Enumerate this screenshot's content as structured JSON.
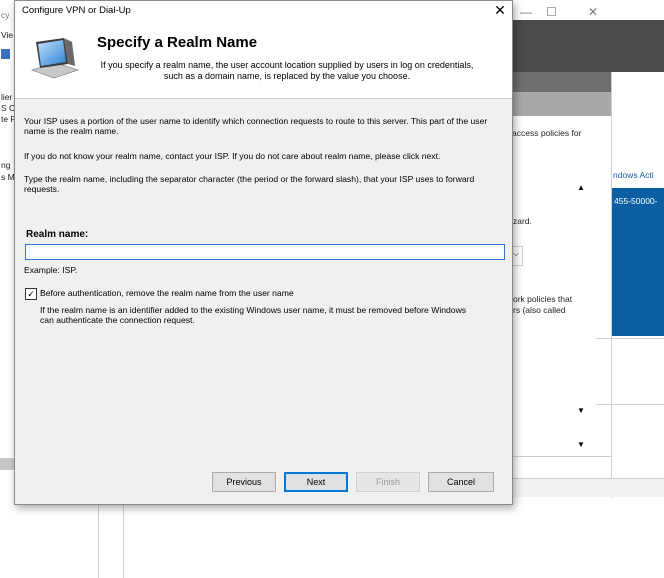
{
  "background": {
    "left_fragments": [
      "cy",
      "Vie",
      "lier",
      "S C",
      "te F",
      "ng",
      "s M"
    ],
    "right_texts": {
      "access_policies": "access policies for",
      "windows_activation": "ndows Acti",
      "product_id": "455-50000-",
      "wizard": "zard.",
      "network_policies_1": "ork policies that",
      "network_policies_2": "rs (also called"
    },
    "minimize_glyph": "—",
    "maximize_glyph": "☐",
    "close_glyph": "✕",
    "scroll_up_glyph": "▲",
    "dropdown_glyph": "▼",
    "chevron_glyph": "⌵"
  },
  "dialog": {
    "title": "Configure VPN or Dial-Up",
    "close_glyph": "✕",
    "header": {
      "title": "Specify a Realm Name",
      "description": "If you specify a realm name, the user account location supplied by users in log on credentials, such as a domain name, is replaced by the value you choose."
    },
    "body": {
      "para1": "Your ISP uses a portion of the user name to identify which connection requests to route to this server. This part of the user name is the realm name.",
      "para2": "If you do not know your realm name, contact your ISP. If you do not care about realm name, please click next.",
      "para3": "Type the realm name, including the separator character (the period or the forward slash), that your ISP uses to forward requests.",
      "realm_label": "Realm name:",
      "realm_value": "",
      "example": "Example: ISP.",
      "checkbox_label": "Before authentication, remove the realm name from the user name",
      "checkbox_checked": true,
      "checkbox_glyph": "✓",
      "checkbox_note": "If the realm name is an identifier added to the existing Windows user name, it must be removed before Windows can authenticate the connection request."
    },
    "buttons": {
      "previous": "Previous",
      "next": "Next",
      "finish": "Finish",
      "cancel": "Cancel"
    }
  }
}
